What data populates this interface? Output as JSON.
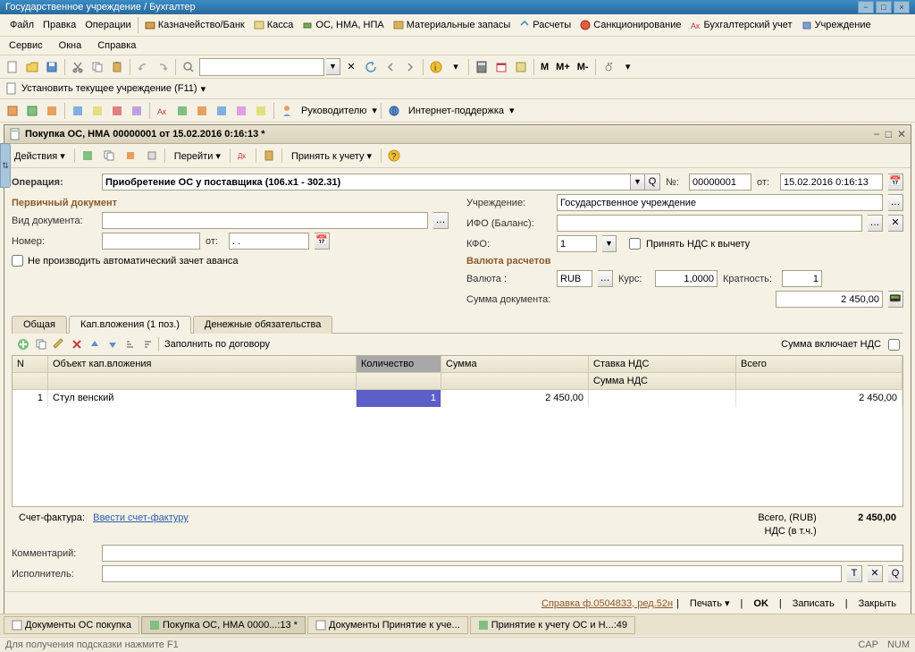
{
  "window_title": "Государственное учреждение / Бухгалтер",
  "main_menu": {
    "file": "Файл",
    "edit": "Правка",
    "operations": "Операции",
    "treasury": "Казначейство/Банк",
    "cash": "Касса",
    "os": "ОС, НМА, НПА",
    "materials": "Материальные запасы",
    "calc": "Расчеты",
    "sanction": "Санкционирование",
    "accounting": "Бухгалтерский учет",
    "institution": "Учреждение"
  },
  "main_menu2": {
    "service": "Сервис",
    "windows": "Окна",
    "help": "Справка"
  },
  "m_buttons": {
    "m": "М",
    "mp": "М+",
    "mm": "М-"
  },
  "set_inst": "Установить текущее учреждение (F11)",
  "tb3": {
    "leader": "Руководителю",
    "support": "Интернет-поддержка"
  },
  "doc": {
    "title": "Покупка ОС, НМА 00000001 от 15.02.2016 0:16:13 *",
    "actions": "Действия",
    "goto": "Перейти",
    "accept": "Принять к учету",
    "op_label": "Операция:",
    "op_value": "Приобретение ОС у поставщика (106.x1 - 302.31)",
    "num_label": "№:",
    "num_value": "00000001",
    "date_label": "от:",
    "date_value": "15.02.2016 0:16:13",
    "prim_doc": "Первичный документ",
    "doc_type": "Вид документа:",
    "number": "Номер:",
    "from": "от:",
    "inst_label": "Учреждение:",
    "inst_value": "Государственное учреждение",
    "ifo": "ИФО (Баланс):",
    "kfo": "КФО:",
    "kfo_value": "1",
    "nds_check": "Принять НДС к вычету",
    "currency_calc": "Валюта расчетов",
    "currency": "Валюта :",
    "currency_value": "RUB",
    "rate": "Курс:",
    "rate_value": "1,0000",
    "mult": "Кратность:",
    "mult_value": "1",
    "doc_sum": "Сумма документа:",
    "doc_sum_value": "2 450,00",
    "no_auto": "Не производить автоматический зачет аванса"
  },
  "tabs": {
    "general": "Общая",
    "cap": "Кап.вложения (1 поз.)",
    "money": "Денежные обязательства"
  },
  "grid_tb": {
    "fill": "Заполнить по договору",
    "incl_nds": "Сумма включает НДС"
  },
  "grid": {
    "h_n": "N",
    "h_obj": "Объект кап.вложения",
    "h_qty": "Количество",
    "h_sum": "Сумма",
    "h_vat": "Ставка НДС",
    "h_tot": "Всего",
    "h_vat_sum": "Сумма НДС",
    "r1_n": "1",
    "r1_obj": "Стул венский",
    "r1_qty": "1",
    "r1_sum": "2 450,00",
    "r1_tot": "2 450,00"
  },
  "totals": {
    "sf": "Счет-фактура:",
    "sf_link": "Ввести счет-фактуру",
    "total_label": "Всего, (RUB)",
    "total_value": "2 450,00",
    "nds_label": "НДС (в т.ч.)"
  },
  "bottom_fields": {
    "comment": "Комментарий:",
    "executor": "Исполнитель:"
  },
  "bottom_btns": {
    "ref": "Справка ф.0504833, ред.52н",
    "print": "Печать",
    "ok": "OK",
    "save": "Записать",
    "close": "Закрыть"
  },
  "tasks": {
    "t1": "Документы ОС покупка",
    "t2": "Покупка ОС, НМА 0000...:13 *",
    "t3": "Документы Принятие к уче...",
    "t4": "Принятие к учету ОС и Н...:49"
  },
  "status": {
    "hint": "Для получения подсказки нажмите F1",
    "cap": "CAP",
    "num": "NUM"
  }
}
